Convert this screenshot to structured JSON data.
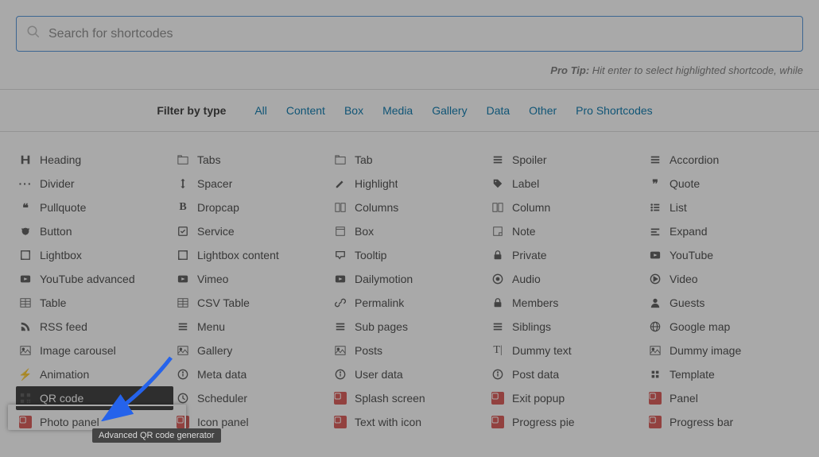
{
  "search": {
    "placeholder": "Search for shortcodes"
  },
  "tip": {
    "label": "Pro Tip:",
    "text": "Hit enter to select highlighted shortcode, while"
  },
  "filter": {
    "label": "Filter by type",
    "links": [
      "All",
      "Content",
      "Box",
      "Media",
      "Gallery",
      "Data",
      "Other",
      "Pro Shortcodes"
    ]
  },
  "columns": [
    [
      {
        "icon": "heading",
        "label": "Heading"
      },
      {
        "icon": "divider",
        "label": "Divider"
      },
      {
        "icon": "pullquote",
        "label": "Pullquote"
      },
      {
        "icon": "button",
        "label": "Button"
      },
      {
        "icon": "lightbox",
        "label": "Lightbox"
      },
      {
        "icon": "yt",
        "label": "YouTube advanced"
      },
      {
        "icon": "table",
        "label": "Table"
      },
      {
        "icon": "rss",
        "label": "RSS feed"
      },
      {
        "icon": "img",
        "label": "Image carousel"
      },
      {
        "icon": "anim",
        "label": "Animation"
      },
      {
        "icon": "qr",
        "label": "QR code",
        "highlight": true
      },
      {
        "icon": "pro",
        "label": "Photo panel"
      }
    ],
    [
      {
        "icon": "tabs",
        "label": "Tabs"
      },
      {
        "icon": "spacer",
        "label": "Spacer"
      },
      {
        "icon": "dropcap",
        "label": "Dropcap"
      },
      {
        "icon": "service",
        "label": "Service"
      },
      {
        "icon": "lightbox",
        "label": "Lightbox content"
      },
      {
        "icon": "yt",
        "label": "Vimeo"
      },
      {
        "icon": "table",
        "label": "CSV Table"
      },
      {
        "icon": "menu",
        "label": "Menu"
      },
      {
        "icon": "img",
        "label": "Gallery"
      },
      {
        "icon": "info",
        "label": "Meta data"
      },
      {
        "icon": "clock",
        "label": "Scheduler"
      },
      {
        "icon": "pro",
        "label": "Icon panel"
      }
    ],
    [
      {
        "icon": "tabs",
        "label": "Tab"
      },
      {
        "icon": "highlight",
        "label": "Highlight"
      },
      {
        "icon": "cols",
        "label": "Columns"
      },
      {
        "icon": "box",
        "label": "Box"
      },
      {
        "icon": "tooltip",
        "label": "Tooltip"
      },
      {
        "icon": "yt",
        "label": "Dailymotion"
      },
      {
        "icon": "link",
        "label": "Permalink"
      },
      {
        "icon": "menu",
        "label": "Sub pages"
      },
      {
        "icon": "img",
        "label": "Posts"
      },
      {
        "icon": "info",
        "label": "User data"
      },
      {
        "icon": "pro",
        "label": "Splash screen"
      },
      {
        "icon": "pro",
        "label": "Text with icon"
      }
    ],
    [
      {
        "icon": "menu",
        "label": "Spoiler"
      },
      {
        "icon": "tag",
        "label": "Label"
      },
      {
        "icon": "cols",
        "label": "Column"
      },
      {
        "icon": "note",
        "label": "Note"
      },
      {
        "icon": "lock",
        "label": "Private"
      },
      {
        "icon": "audio",
        "label": "Audio"
      },
      {
        "icon": "lock",
        "label": "Members"
      },
      {
        "icon": "menu",
        "label": "Siblings"
      },
      {
        "icon": "dummy",
        "label": "Dummy text"
      },
      {
        "icon": "info",
        "label": "Post data"
      },
      {
        "icon": "pro",
        "label": "Exit popup"
      },
      {
        "icon": "pro",
        "label": "Progress pie"
      }
    ],
    [
      {
        "icon": "menu",
        "label": "Accordion"
      },
      {
        "icon": "quote",
        "label": "Quote"
      },
      {
        "icon": "list",
        "label": "List"
      },
      {
        "icon": "expand",
        "label": "Expand"
      },
      {
        "icon": "yt",
        "label": "YouTube"
      },
      {
        "icon": "video",
        "label": "Video"
      },
      {
        "icon": "user",
        "label": "Guests"
      },
      {
        "icon": "globe",
        "label": "Google map"
      },
      {
        "icon": "img",
        "label": "Dummy image"
      },
      {
        "icon": "template",
        "label": "Template"
      },
      {
        "icon": "pro",
        "label": "Panel"
      },
      {
        "icon": "pro",
        "label": "Progress bar"
      }
    ]
  ],
  "tooltip": "Advanced QR code generator"
}
